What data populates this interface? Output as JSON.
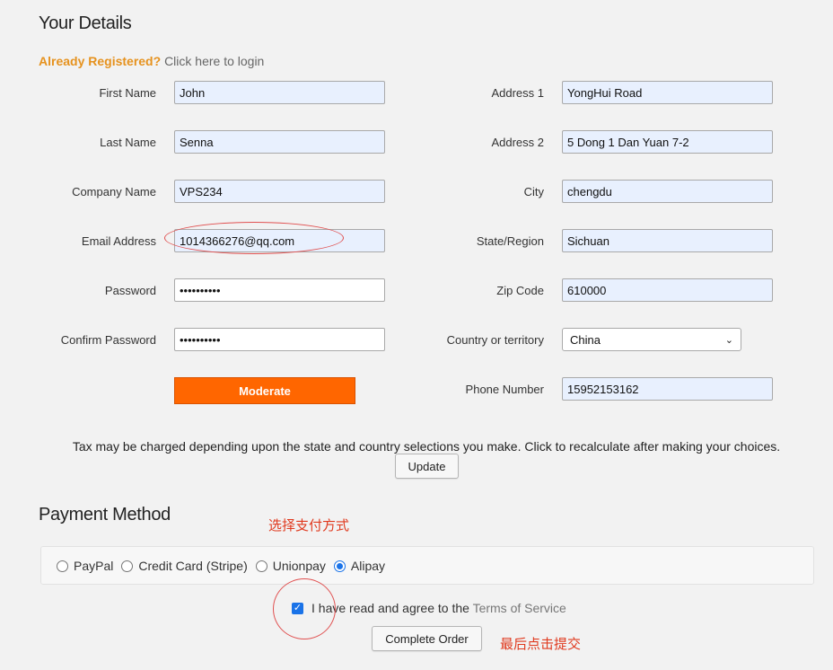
{
  "details": {
    "heading": "Your Details",
    "already_registered": "Already Registered?",
    "click_login": "Click here to login",
    "left_fields": [
      {
        "label": "First Name",
        "value": "John",
        "type": "text"
      },
      {
        "label": "Last Name",
        "value": "Senna",
        "type": "text"
      },
      {
        "label": "Company Name",
        "value": "VPS234",
        "type": "text"
      },
      {
        "label": "Email Address",
        "value": "1014366276@qq.com",
        "type": "text"
      },
      {
        "label": "Password",
        "value": "••••••••••",
        "type": "password"
      },
      {
        "label": "Confirm Password",
        "value": "••••••••••",
        "type": "password"
      }
    ],
    "right_fields": [
      {
        "label": "Address 1",
        "value": "YongHui Road"
      },
      {
        "label": "Address 2",
        "value": "5 Dong 1 Dan Yuan 7-2"
      },
      {
        "label": "City",
        "value": "chengdu"
      },
      {
        "label": "State/Region",
        "value": "Sichuan"
      },
      {
        "label": "Zip Code",
        "value": "610000"
      },
      {
        "label": "Country or territory",
        "value": "China"
      },
      {
        "label": "Phone Number",
        "value": "15952153162"
      }
    ],
    "strength_label": "Moderate",
    "tax_note": "Tax may be charged depending upon the state and country selections you make. Click to recalculate after making your choices.",
    "update_label": "Update"
  },
  "payment": {
    "heading": "Payment Method",
    "annotation_select": "选择支付方式",
    "options": [
      {
        "label": "PayPal",
        "checked": false
      },
      {
        "label": "Credit Card (Stripe)",
        "checked": false
      },
      {
        "label": "Unionpay",
        "checked": false
      },
      {
        "label": "Alipay",
        "checked": true
      }
    ],
    "agree_prefix": "I have read and agree to the",
    "terms_link": "Terms of Service",
    "complete_label": "Complete Order",
    "annotation_submit": "最后点击提交"
  },
  "colors": {
    "accent_orange": "#ff6600",
    "registered_orange": "#e6921e",
    "annotation_red": "#e03a1f",
    "radio_blue": "#1a73e8",
    "autofill_bg": "#e8f0fe"
  }
}
